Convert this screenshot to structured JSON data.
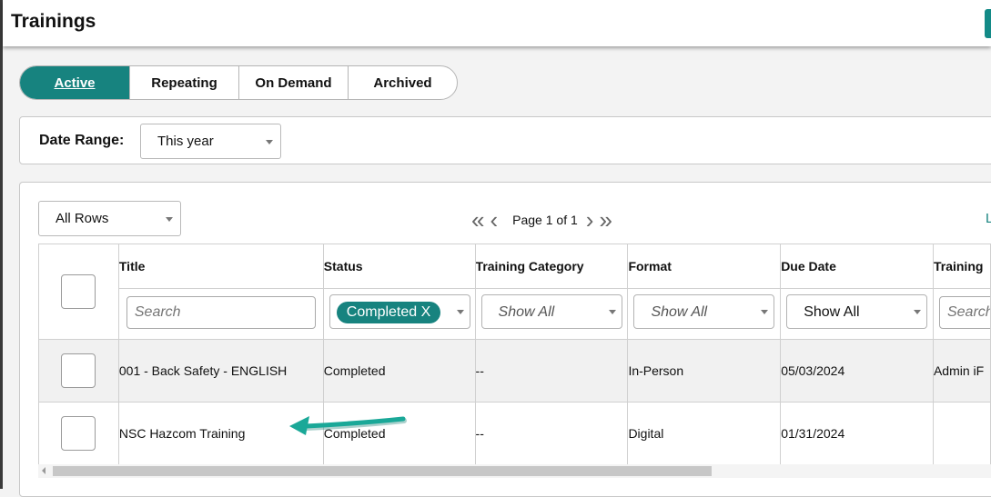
{
  "page": {
    "title": "Trainings"
  },
  "tabs": [
    {
      "label": "Active",
      "active": true
    },
    {
      "label": "Repeating",
      "active": false
    },
    {
      "label": "On Demand",
      "active": false
    },
    {
      "label": "Archived",
      "active": false
    }
  ],
  "filters": {
    "date_range_label": "Date Range:",
    "date_range_value": "This year"
  },
  "grid": {
    "rows_selector": "All Rows",
    "pager_text": "Page 1 of 1",
    "corner_link": "L",
    "columns": [
      "Title",
      "Status",
      "Training Category",
      "Format",
      "Due Date",
      "Training"
    ],
    "filter_row": {
      "title_placeholder": "Search",
      "status_chip": "Completed  X",
      "category": "Show All",
      "format": "Show All",
      "due_date": "Show All",
      "training_placeholder": "Search"
    },
    "rows": [
      {
        "title": "001 - Back Safety - ENGLISH",
        "status": "Completed",
        "category": "--",
        "format": "In-Person",
        "due_date": "05/03/2024",
        "training": "Admin iF"
      },
      {
        "title": "NSC Hazcom Training",
        "status": "Completed",
        "category": "--",
        "format": "Digital",
        "due_date": "01/31/2024",
        "training": ""
      }
    ]
  },
  "colors": {
    "accent": "#17837f",
    "annotation_arrow": "#1aa898"
  }
}
